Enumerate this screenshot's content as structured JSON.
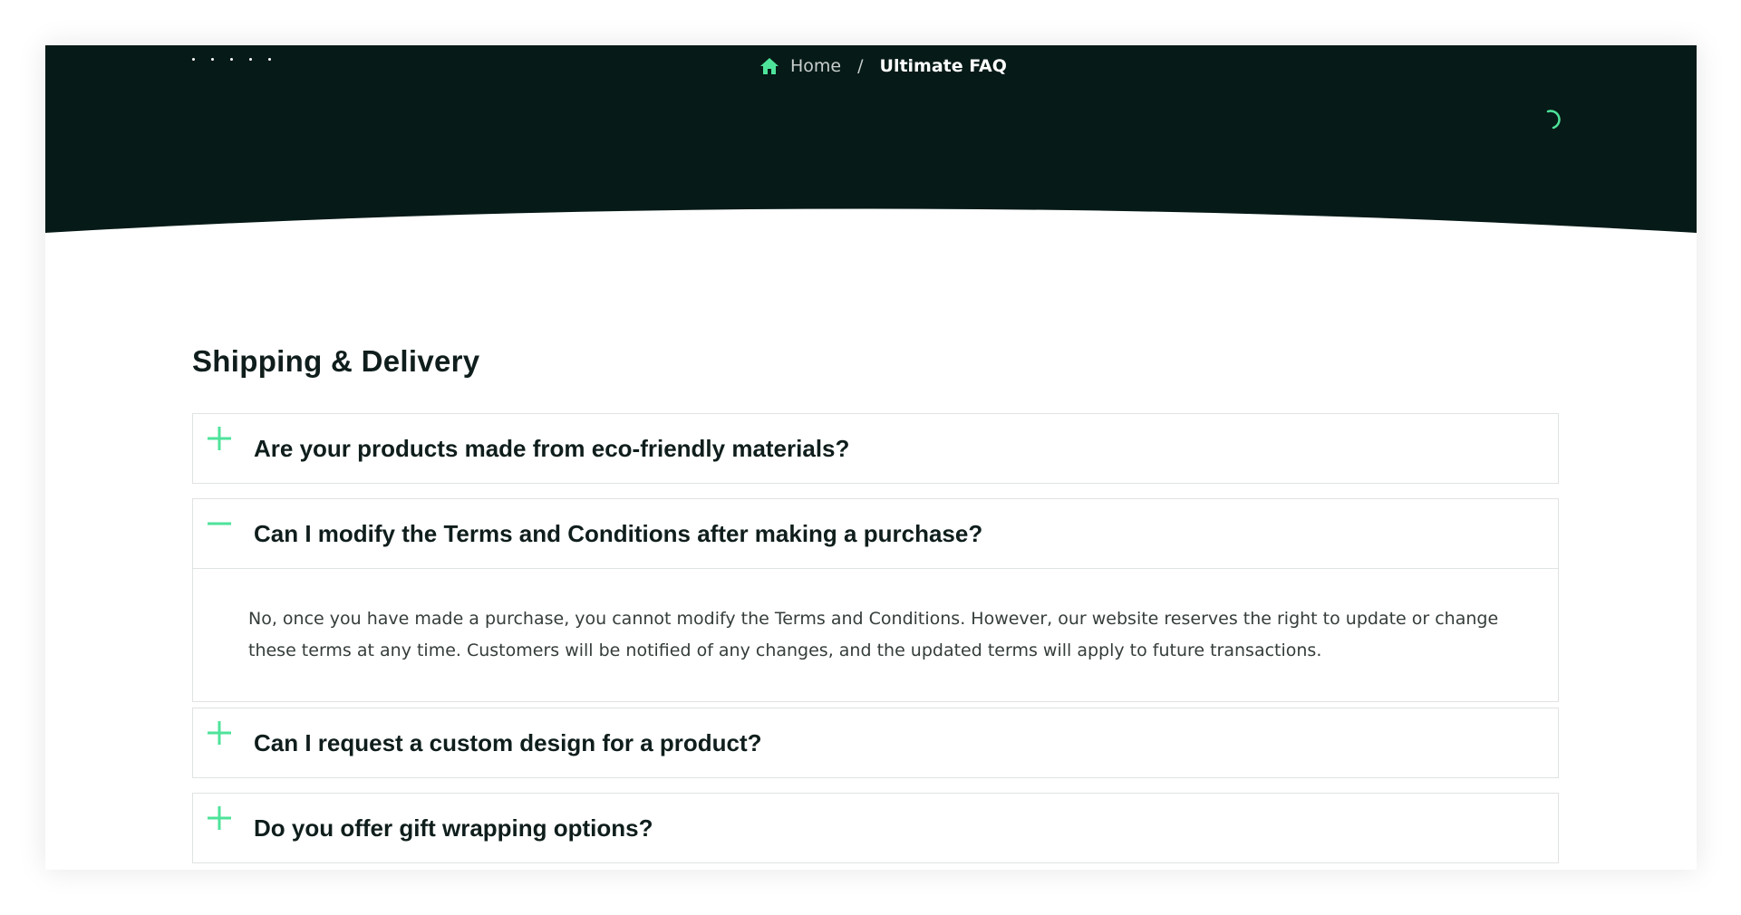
{
  "breadcrumb": {
    "home_label": "Home",
    "separator": "/",
    "current_label": "Ultimate FAQ"
  },
  "section": {
    "title": "Shipping & Delivery"
  },
  "faq": [
    {
      "question": "Are your products made from eco-friendly materials?",
      "expanded": false,
      "icon": "plus-icon"
    },
    {
      "question": "Can I modify the Terms and Conditions after making a purchase?",
      "expanded": true,
      "icon": "minus-icon",
      "answer": "No, once you have made a purchase, you cannot modify the Terms and Conditions. However, our website reserves the right to update or change these terms at any time. Customers will be notified of any changes, and the updated terms will apply to future transactions."
    },
    {
      "question": "Can I request a custom design for a product?",
      "expanded": false,
      "icon": "plus-icon"
    },
    {
      "question": "Do you offer gift wrapping options?",
      "expanded": false,
      "icon": "plus-icon"
    }
  ],
  "colors": {
    "hero_background": "#061a17",
    "accent": "#4ee39a",
    "text_dark": "#0f1e1c",
    "border": "#dfe3e2"
  },
  "icons": {
    "home": "home-icon",
    "loading": "loading-spinner-icon",
    "decorative_dots": "dots-decoration"
  }
}
